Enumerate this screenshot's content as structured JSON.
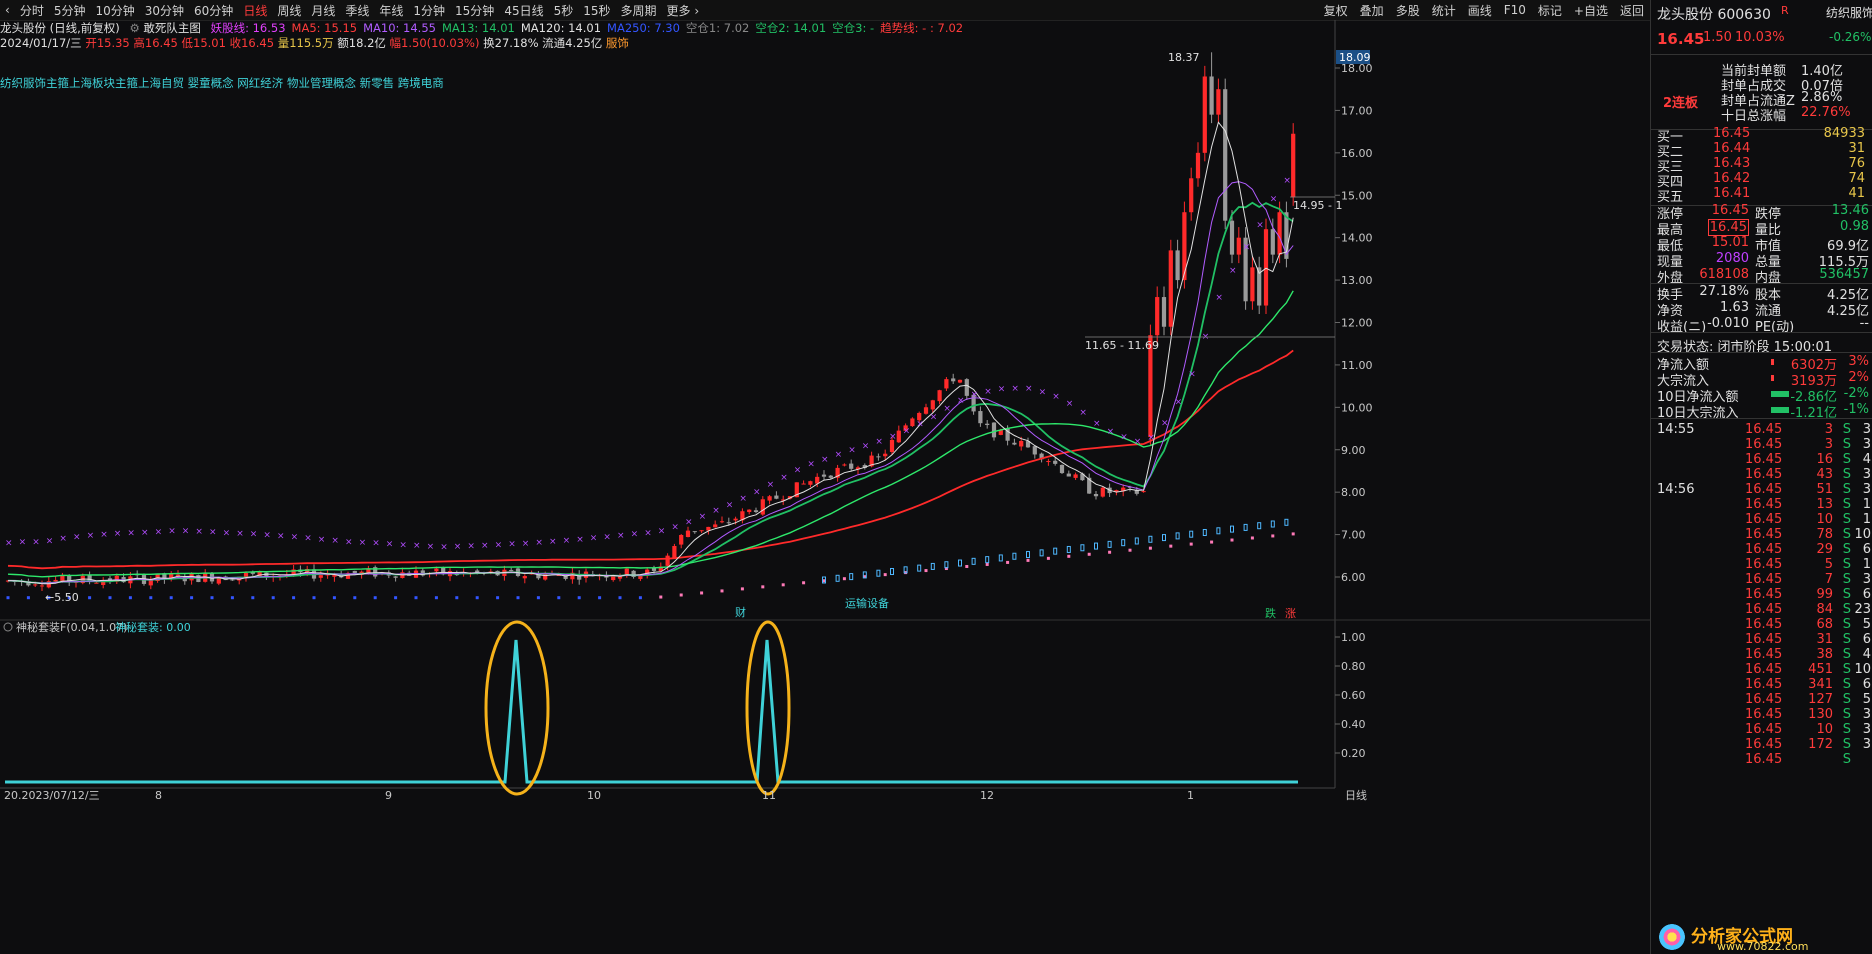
{
  "toolbar": {
    "periods": [
      "分时",
      "5分钟",
      "10分钟",
      "30分钟",
      "60分钟",
      "日线",
      "周线",
      "月线",
      "季线",
      "年线",
      "1分钟",
      "15分钟",
      "45日线",
      "5秒",
      "15秒",
      "多周期",
      "更多 ›"
    ],
    "active_index": 5,
    "right_items": [
      "复权",
      "叠加",
      "多股",
      "统计",
      "画线",
      "F10",
      "标记",
      "+自选",
      "返回"
    ]
  },
  "header": {
    "stock_name": "龙头股份 (日线,前复权)",
    "indicator_name": "敢死队主图",
    "indicators": [
      {
        "label": "妖股线: 16.53",
        "color": "#e040fb"
      },
      {
        "label": "MA5: 15.15",
        "color": "#ff3b3b"
      },
      {
        "label": "MA10: 14.55",
        "color": "#b05cff"
      },
      {
        "label": "MA13: 14.01",
        "color": "#21c065"
      },
      {
        "label": "MA120: 14.01",
        "color": "#e0e0e0"
      },
      {
        "label": "MA250: 7.30",
        "color": "#3355ff"
      },
      {
        "label": "空仓1: 7.02",
        "color": "#888888"
      },
      {
        "label": "空仓2: 14.01",
        "color": "#21c065"
      },
      {
        "label": "空仓3: -",
        "color": "#21c065"
      },
      {
        "label": "趋势线: - : 7.02",
        "color": "#ff3b3b"
      }
    ],
    "ohlc": {
      "date": "2024/01/17/三",
      "open": "开15.35",
      "high": "高16.45",
      "low": "低15.01",
      "close": "收16.45",
      "vol": "量115.5万",
      "amount": "额18.2亿",
      "change": "幅1.50(10.03%)",
      "turnover": "换27.18%",
      "float": "流通4.25亿",
      "sector": "服饰"
    },
    "concepts": "纺织服饰主箍上海板块主箍上海自贸 婴童概念 网红经济 物业管理概念 新零售 跨境电商"
  },
  "main_chart": {
    "y_ticks": [
      "18.00",
      "17.00",
      "16.00",
      "15.00",
      "14.00",
      "13.00",
      "12.00",
      "11.00",
      "10.00",
      "9.00",
      "8.00",
      "7.00",
      "6.00"
    ],
    "price_badge": "18.09",
    "annotations": {
      "high": "18.37",
      "low": "←5.50",
      "range_label": "11.65 - 11.69",
      "right_label": "14.95 - 1",
      "event1": "财",
      "event2": "运输设备",
      "event3": "跌",
      "event4": "涨"
    }
  },
  "sub_chart": {
    "title": "神秘套装F(0.04,1.07)",
    "value": "神秘套装: 0.00",
    "y_ticks": [
      "1.00",
      "0.80",
      "0.60",
      "0.40",
      "0.20"
    ]
  },
  "x_axis": {
    "labels": [
      "20.2023/07/12/三",
      "8",
      "9",
      "10",
      "11",
      "12",
      "1"
    ],
    "period": "日线"
  },
  "quote": {
    "name": "龙头股份 600630",
    "r_badge": "R",
    "tab": "纺织服饰",
    "price": "16.45",
    "change": "1.50",
    "pct": "10.03%",
    "sector_pct": "-0.26%",
    "board": "2连板",
    "seal_info": [
      {
        "label": "当前封单额",
        "value": "1.40亿"
      },
      {
        "label": "封单占成交",
        "value": "0.07倍"
      },
      {
        "label": "封单占流通Z",
        "value": "2.86%"
      },
      {
        "label": "十日总涨幅",
        "value": "22.76%"
      }
    ],
    "bids": [
      {
        "label": "买一",
        "price": "16.45",
        "vol": "84933"
      },
      {
        "label": "买二",
        "price": "16.44",
        "vol": "31"
      },
      {
        "label": "买三",
        "price": "16.43",
        "vol": "76"
      },
      {
        "label": "买四",
        "price": "16.42",
        "vol": "74"
      },
      {
        "label": "买五",
        "price": "16.41",
        "vol": "41"
      }
    ],
    "stats": [
      [
        "涨停",
        "16.45",
        "跌停",
        "13.46"
      ],
      [
        "最高",
        "16.45",
        "量比",
        "0.98"
      ],
      [
        "最低",
        "15.01",
        "市值",
        "69.9亿"
      ],
      [
        "现量",
        "2080",
        "总量",
        "115.5万"
      ],
      [
        "外盘",
        "618108",
        "内盘",
        "536457"
      ]
    ],
    "stats2": [
      [
        "换手",
        "27.18%",
        "股本",
        "4.25亿"
      ],
      [
        "净资",
        "1.63",
        "流通",
        "4.25亿"
      ],
      [
        "收益(ニ)",
        "-0.010",
        "PE(动)",
        "--"
      ]
    ],
    "status": "交易状态: 闭市阶段 15:00:01",
    "flows": [
      {
        "label": "净流入额",
        "value": "6302万",
        "pct": "3%",
        "color": "#ff3b3b"
      },
      {
        "label": "大宗流入",
        "value": "3193万",
        "pct": "2%",
        "color": "#ff3b3b"
      },
      {
        "label": "10日净流入额",
        "value": "-2.86亿",
        "pct": "-2%",
        "color": "#21c065"
      },
      {
        "label": "10日大宗流入",
        "value": "-1.21亿",
        "pct": "-1%",
        "color": "#21c065"
      }
    ],
    "ticks": [
      {
        "time": "14:55",
        "price": "16.45",
        "vol": "3",
        "bs": "S",
        "n": "3"
      },
      {
        "time": "",
        "price": "16.45",
        "vol": "3",
        "bs": "S",
        "n": "3"
      },
      {
        "time": "",
        "price": "16.45",
        "vol": "16",
        "bs": "S",
        "n": "4"
      },
      {
        "time": "",
        "price": "16.45",
        "vol": "43",
        "bs": "S",
        "n": "3"
      },
      {
        "time": "14:56",
        "price": "16.45",
        "vol": "51",
        "bs": "S",
        "n": "3"
      },
      {
        "time": "",
        "price": "16.45",
        "vol": "13",
        "bs": "S",
        "n": "1"
      },
      {
        "time": "",
        "price": "16.45",
        "vol": "10",
        "bs": "S",
        "n": "1"
      },
      {
        "time": "",
        "price": "16.45",
        "vol": "78",
        "bs": "S",
        "n": "10"
      },
      {
        "time": "",
        "price": "16.45",
        "vol": "29",
        "bs": "S",
        "n": "6"
      },
      {
        "time": "",
        "price": "16.45",
        "vol": "5",
        "bs": "S",
        "n": "1"
      },
      {
        "time": "",
        "price": "16.45",
        "vol": "7",
        "bs": "S",
        "n": "3"
      },
      {
        "time": "",
        "price": "16.45",
        "vol": "99",
        "bs": "S",
        "n": "6"
      },
      {
        "time": "",
        "price": "16.45",
        "vol": "84",
        "bs": "S",
        "n": "23"
      },
      {
        "time": "",
        "price": "16.45",
        "vol": "68",
        "bs": "S",
        "n": "5"
      },
      {
        "time": "",
        "price": "16.45",
        "vol": "31",
        "bs": "S",
        "n": "6"
      },
      {
        "time": "",
        "price": "16.45",
        "vol": "38",
        "bs": "S",
        "n": "4"
      },
      {
        "time": "",
        "price": "16.45",
        "vol": "451",
        "bs": "S",
        "n": "10"
      },
      {
        "time": "",
        "price": "16.45",
        "vol": "341",
        "bs": "S",
        "n": "6"
      },
      {
        "time": "",
        "price": "16.45",
        "vol": "127",
        "bs": "S",
        "n": "5"
      },
      {
        "time": "",
        "price": "16.45",
        "vol": "130",
        "bs": "S",
        "n": "3"
      },
      {
        "time": "",
        "price": "16.45",
        "vol": "10",
        "bs": "S",
        "n": "3"
      },
      {
        "time": "",
        "price": "16.45",
        "vol": "172",
        "bs": "S",
        "n": "3"
      },
      {
        "time": "",
        "price": "16.45",
        "vol": "",
        "bs": "S",
        "n": ""
      }
    ],
    "watermark": "分析家公式网",
    "watermark_url": "www.70822.com"
  },
  "colors": {
    "up": "#ff2a2a",
    "down": "#21c065",
    "flat": "#9a9a9a",
    "bg": "#0d0d0f",
    "cyan": "#3fd2d8",
    "orange": "#f5b21a"
  }
}
